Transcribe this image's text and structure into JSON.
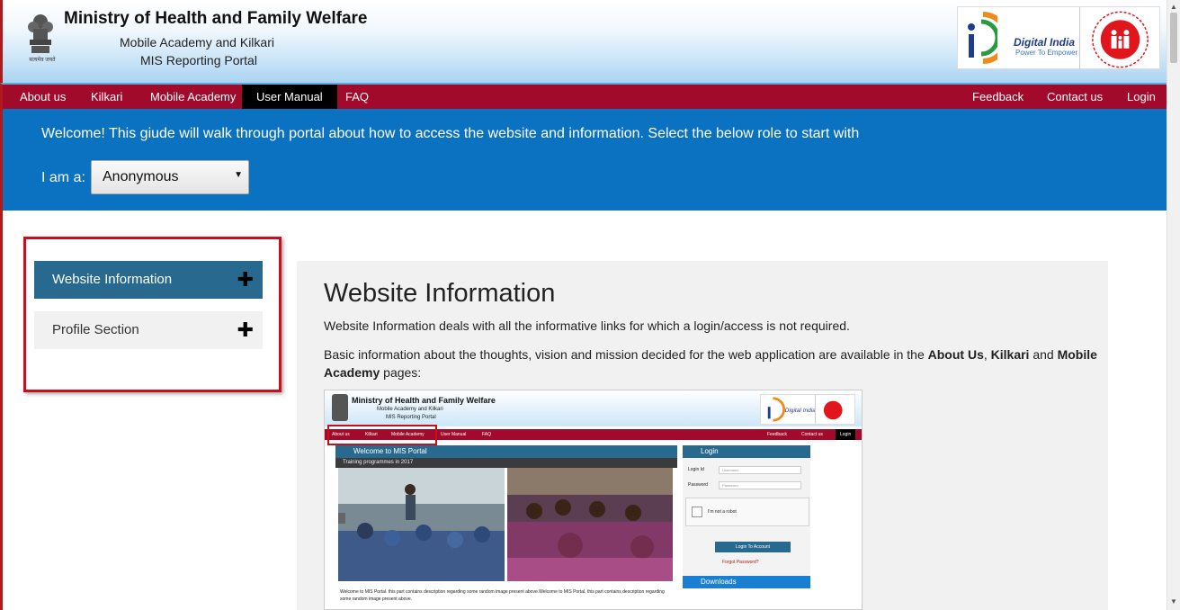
{
  "header": {
    "title": "Ministry of Health and Family Welfare",
    "subtitle_line1": "Mobile Academy and Kilkari",
    "subtitle_line2": "MIS Reporting Portal",
    "emblem_caption": "सत्यमेव जयते",
    "digital_india_name": "Digital India",
    "digital_india_tagline": "Power To Empower"
  },
  "nav": {
    "left_items": [
      "About us",
      "Kilkari",
      "Mobile Academy",
      "User Manual",
      "FAQ"
    ],
    "active": "User Manual",
    "right_items": [
      "Feedback",
      "Contact us",
      "Login"
    ]
  },
  "welcome": {
    "text": "Welcome! This giude will walk through portal about how to access the website and information. Select the below role to start with",
    "role_label": "I am a:",
    "role_selected": "Anonymous"
  },
  "sidebar": {
    "items": [
      {
        "label": "Website Information",
        "icon": "plus-icon",
        "selected": true
      },
      {
        "label": "Profile Section",
        "icon": "plus-icon",
        "selected": false
      }
    ]
  },
  "content": {
    "title": "Website Information",
    "para1": "Website Information deals with all the informative links for which a login/access is not required.",
    "para2_prefix": "Basic information about the thoughts, vision and mission decided for the web application are available in the ",
    "para2_about": "About Us",
    "para2_sep1": ", ",
    "para2_kilkari": "Kilkari",
    "para2_sep2": " and ",
    "para2_mobile": "Mobile Academy",
    "para2_suffix": " pages:"
  },
  "screenshot": {
    "title": "Ministry of Health and Family Welfare",
    "sub1": "Mobile Academy and Kilkari",
    "sub2": "MIS Reporting Portal",
    "nav_left": [
      "About us",
      "Kilkari",
      "Mobile Academy",
      "User Manual",
      "FAQ"
    ],
    "nav_right": [
      "Feedback",
      "Contact us",
      "Login"
    ],
    "panel_title": "Welcome to MIS Portal",
    "panel_subtitle": "Training programmes in 2017",
    "caption": "Welcome to MIS Portal. this part contains description regarding some random image present above.Welcome to MIS Portal. this part contains description regarding some random image present above.",
    "login_title": "Login",
    "login_id_label": "Login Id",
    "login_id_placeholder": "Username",
    "password_label": "Password",
    "password_placeholder": "Password",
    "captcha_text": "I'm not a robot",
    "login_button": "Login To Account",
    "forgot": "Forgot Password?",
    "downloads_title": "Downloads"
  },
  "colors": {
    "nav_bg": "#a10a2a",
    "band_bg": "#0b72c1",
    "accordion_active": "#286a8f",
    "highlight_border": "#c6101b"
  }
}
